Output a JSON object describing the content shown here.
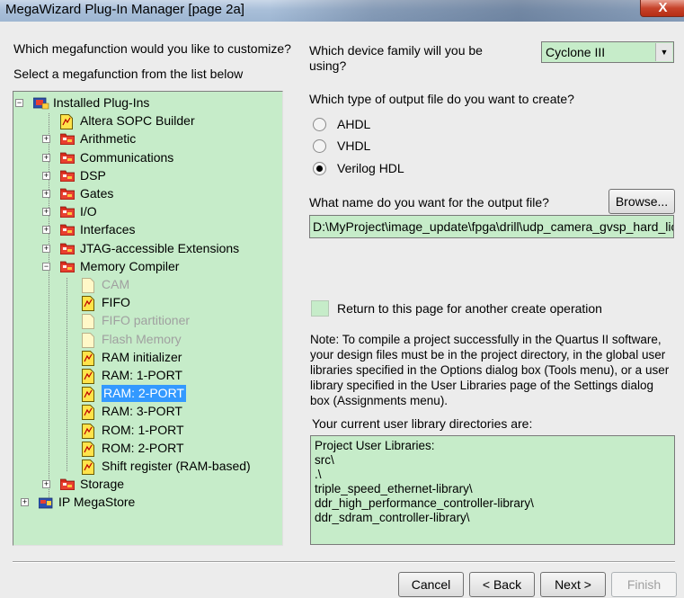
{
  "window": {
    "title": "MegaWizard Plug-In Manager [page 2a]",
    "close_label": "X"
  },
  "left": {
    "question": "Which megafunction would you like to customize?",
    "instruction": "Select a megafunction from the list below",
    "tree": {
      "root": "Installed Plug-Ins",
      "items": [
        "Altera SOPC Builder",
        "Arithmetic",
        "Communications",
        "DSP",
        "Gates",
        "I/O",
        "Interfaces",
        "JTAG-accessible Extensions",
        "Memory Compiler",
        "Storage",
        "IP MegaStore"
      ],
      "memory_children": [
        "CAM",
        "FIFO",
        "FIFO partitioner",
        "Flash Memory",
        "RAM initializer",
        "RAM: 1-PORT",
        "RAM: 2-PORT",
        "RAM: 3-PORT",
        "ROM: 1-PORT",
        "ROM: 2-PORT",
        "Shift register (RAM-based)"
      ]
    }
  },
  "right": {
    "device_question": "Which device family will you be using?",
    "device_family": "Cyclone III",
    "output_type_question": "Which type of output file do you want to create?",
    "output_types": [
      "AHDL",
      "VHDL",
      "Verilog HDL"
    ],
    "output_name_question": "What name do you want for the output file?",
    "browse_label": "Browse...",
    "output_file": "D:\\MyProject\\image_update\\fpga\\drill\\udp_camera_gvsp_hard_lic",
    "return_label": "Return to this page for another create operation",
    "note": "Note: To compile a project successfully in the Quartus II software, your design files must be in the project directory, in the global user libraries specified in the Options dialog box (Tools menu), or a user library specified in the User Libraries page of the Settings dialog box (Assignments menu).",
    "libraries_label": "Your current user library directories are:",
    "libraries": [
      "Project User Libraries:",
      "src\\",
      ".\\",
      "triple_speed_ethernet-library\\",
      "ddr_high_performance_controller-library\\",
      "ddr_sdram_controller-library\\"
    ]
  },
  "buttons": {
    "cancel": "Cancel",
    "back": "< Back",
    "next": "Next >",
    "finish": "Finish"
  }
}
